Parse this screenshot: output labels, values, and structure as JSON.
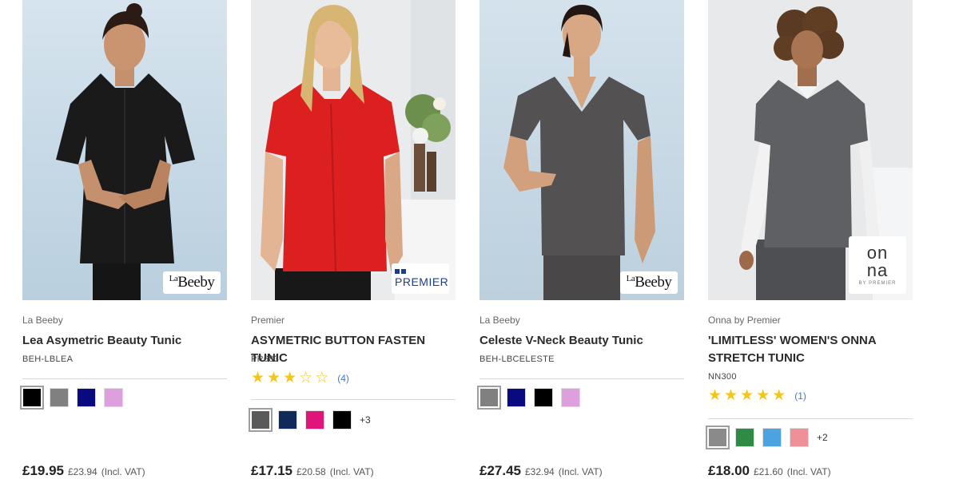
{
  "products": [
    {
      "brand": "La Beeby",
      "name": "Lea Asymetric Beauty Tunic",
      "sku": "BEH-LBLEA",
      "logo": {
        "kind": "labeeby",
        "text_sup": "La",
        "text": "Beeby"
      },
      "swatches": [
        "#000000",
        "#808080",
        "#0a0a80",
        "#dda0dd"
      ],
      "price": "£19.95",
      "old_price": "£23.94",
      "vat_note": "(Incl. VAT)"
    },
    {
      "brand": "Premier",
      "name": "ASYMETRIC BUTTON FASTEN TUNIC",
      "sku": "PR683",
      "logo": {
        "kind": "premier",
        "text": "PREMIER"
      },
      "rating": {
        "stars": 3,
        "out_of": 5,
        "reviews": "(4)"
      },
      "swatches": [
        "#5a5a5a",
        "#0f2a5a",
        "#e0157a",
        "#000000"
      ],
      "more": "+3",
      "price": "£17.15",
      "old_price": "£20.58",
      "vat_note": "(Incl. VAT)"
    },
    {
      "brand": "La Beeby",
      "name": "Celeste V-Neck Beauty Tunic",
      "sku": "BEH-LBCELESTE",
      "logo": {
        "kind": "labeeby",
        "text_sup": "La",
        "text": "Beeby"
      },
      "swatches": [
        "#808080",
        "#0a0a80",
        "#000000",
        "#dda0dd"
      ],
      "price": "£27.45",
      "old_price": "£32.94",
      "vat_note": "(Incl. VAT)"
    },
    {
      "brand": "Onna by Premier",
      "name": "'LIMITLESS' WOMEN'S ONNA STRETCH TUNIC",
      "sku": "NN300",
      "logo": {
        "kind": "onna",
        "text_top": "on",
        "text_bottom": "na",
        "text_small": "BY PREMIER"
      },
      "rating": {
        "stars": 5,
        "out_of": 5,
        "reviews": "(1)"
      },
      "swatches": [
        "#8a8a8a",
        "#2e8b45",
        "#4da3e0",
        "#ef8f98"
      ],
      "more": "+2",
      "price": "£18.00",
      "old_price": "£21.60",
      "vat_note": "(Incl. VAT)"
    }
  ],
  "icons": {
    "star_filled": "star-filled-icon",
    "star_empty": "star-empty-icon"
  }
}
